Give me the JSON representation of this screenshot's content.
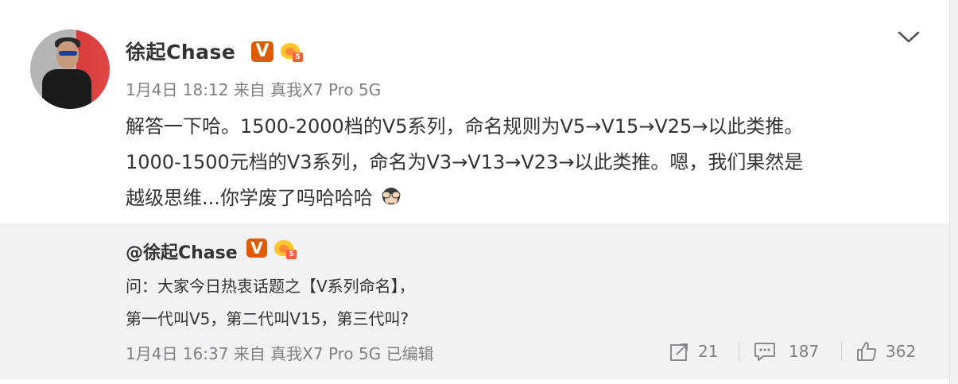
{
  "post": {
    "author": "徐起Chase",
    "meta": "1月4日 18:12 来自 真我X7 Pro 5G",
    "text_lines": [
      "解答一下哈。1500-2000档的V5系列，命名规则为V5→V15→V25→以此类推。",
      "1000-1500元档的V3系列，命名为V3→V13→V23→以此类推。嗯，我们果然是",
      "越级思维...你学废了吗哈哈哈"
    ],
    "badges": {
      "verified": "V",
      "level": "5"
    },
    "emoji_icon": "see-no-evil-emoji",
    "menu_icon": "chevron-down-icon"
  },
  "repost": {
    "author": "@徐起Chase",
    "badges": {
      "verified": "V",
      "level": "5"
    },
    "lines": [
      "问：大家今日热衷话题之【V系列命名】，",
      "第一代叫V5，第二代叫V15，第三代叫?"
    ],
    "meta": "1月4日 16:37 来自 真我X7 Pro 5G   已编辑",
    "actions": {
      "repost_count": "21",
      "comment_count": "187",
      "like_count": "362"
    }
  },
  "colors": {
    "verified_badge": "#e05a00",
    "repost_bg": "#f2f2f5",
    "meta_text": "#808080"
  }
}
